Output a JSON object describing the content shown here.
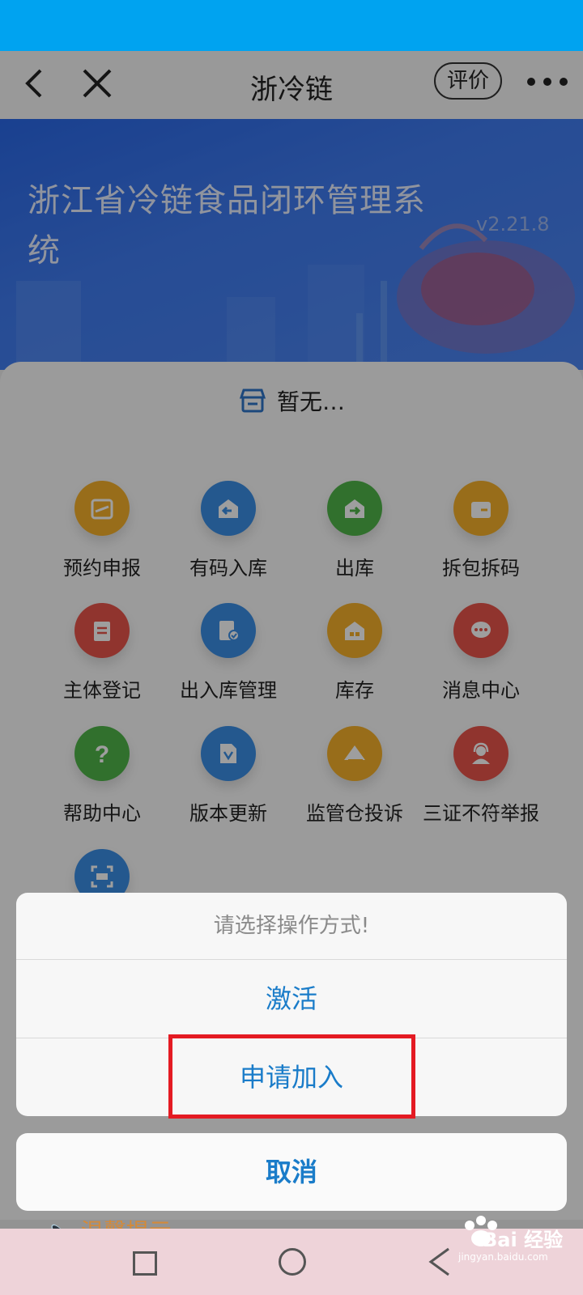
{
  "navbar": {
    "title": "浙冷链",
    "rate_label": "评价"
  },
  "hero": {
    "title": "浙江省冷链食品闭环管理系统",
    "version": "v2.21.8"
  },
  "store": {
    "label": "暂无…"
  },
  "grid": [
    {
      "label": "预约申报",
      "icon": "calendar-icon",
      "color": "#f5b12a"
    },
    {
      "label": "有码入库",
      "icon": "inbound-icon",
      "color": "#3a8ee6"
    },
    {
      "label": "出库",
      "icon": "outbound-icon",
      "color": "#4fb54a"
    },
    {
      "label": "拆包拆码",
      "icon": "wallet-icon",
      "color": "#f5b12a"
    },
    {
      "label": "主体登记",
      "icon": "clipboard-icon",
      "color": "#e9554b"
    },
    {
      "label": "出入库管理",
      "icon": "document-check-icon",
      "color": "#3a8ee6"
    },
    {
      "label": "库存",
      "icon": "warehouse-icon",
      "color": "#f5b12a"
    },
    {
      "label": "消息中心",
      "icon": "chat-icon",
      "color": "#e9554b"
    },
    {
      "label": "帮助中心",
      "icon": "question-icon",
      "color": "#4fb54a"
    },
    {
      "label": "版本更新",
      "icon": "file-update-icon",
      "color": "#3a8ee6"
    },
    {
      "label": "监管仓投诉",
      "icon": "envelope-icon",
      "color": "#f5b12a"
    },
    {
      "label": "三证不符举报",
      "icon": "support-agent-icon",
      "color": "#e9554b"
    }
  ],
  "sheet": {
    "title": "请选择操作方式!",
    "activate_label": "激活",
    "apply_join_label": "申请加入",
    "cancel_label": "取消"
  },
  "tip": {
    "label": "温馨提示"
  },
  "watermark": {
    "brand": "Bai 经验",
    "url": "jingyan.baidu.com"
  },
  "colors": {
    "accent": "#1a7cc9",
    "highlight": "#e41b23",
    "statusbar": "#00a3f0"
  }
}
